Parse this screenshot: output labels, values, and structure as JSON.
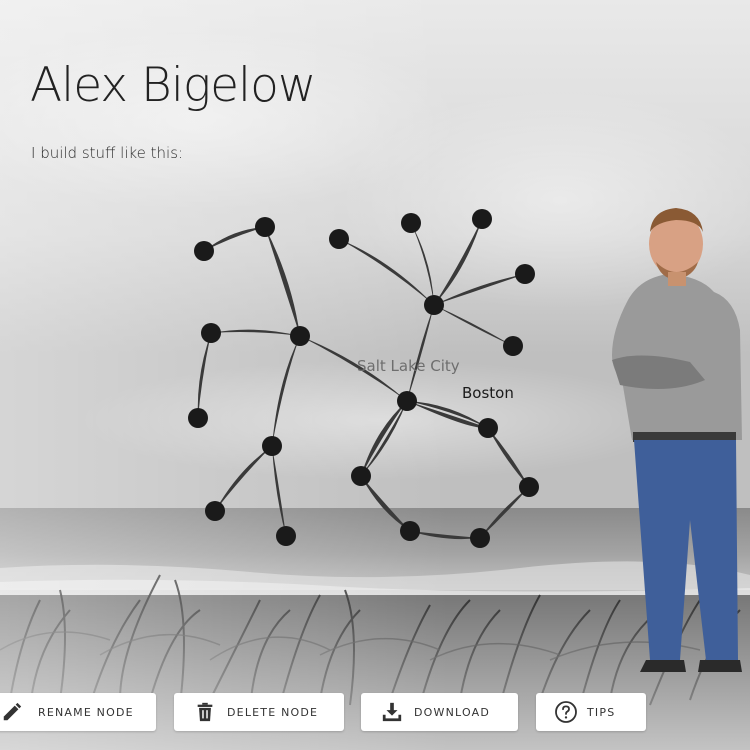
{
  "header": {
    "name": "Alex Bigelow",
    "tagline": "I build stuff like this:"
  },
  "graph": {
    "node_labels": {
      "salt_lake_city": "Salt Lake City",
      "boston": "Boston"
    },
    "node_color": "#1a1a1a",
    "edge_color": "#3a3a3a"
  },
  "toolbar": {
    "rename_label": "RENAME NODE",
    "delete_label": "DELETE NODE",
    "download_label": "DOWNLOAD",
    "tips_label": "TIPS"
  },
  "icons": {
    "rename": "pencil-icon",
    "delete": "trash-icon",
    "download": "download-icon",
    "tips": "question-circle-icon"
  }
}
